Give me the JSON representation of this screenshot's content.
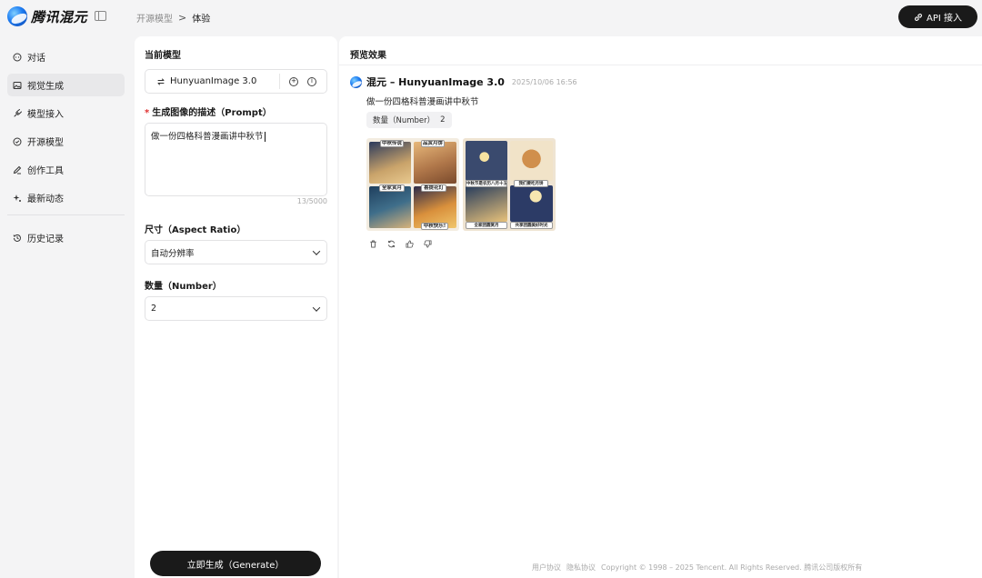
{
  "brand": {
    "name": "腾讯混元"
  },
  "breadcrumb": {
    "parent": "开源模型",
    "separator": ">",
    "current": "体验"
  },
  "header": {
    "api_button": "API 接入"
  },
  "nav": {
    "items": [
      {
        "label": "对话",
        "icon": "chat-icon",
        "active": false
      },
      {
        "label": "视觉生成",
        "icon": "image-icon",
        "active": true
      },
      {
        "label": "模型接入",
        "icon": "plugin-icon",
        "active": false
      },
      {
        "label": "开源模型",
        "icon": "open-source-icon",
        "active": false
      },
      {
        "label": "创作工具",
        "icon": "pen-icon",
        "active": false
      },
      {
        "label": "最新动态",
        "icon": "sparkle-icon",
        "active": false
      }
    ],
    "history": {
      "label": "历史记录",
      "icon": "history-icon"
    }
  },
  "config": {
    "model_section": "当前模型",
    "model_name": "HunyuanImage 3.0",
    "prompt_label": "生成图像的描述（Prompt）",
    "prompt_value": "做一份四格科普漫画讲中秋节",
    "prompt_counter": "13/5000",
    "aspect_label": "尺寸（Aspect Ratio）",
    "aspect_value": "自动分辨率",
    "number_label": "数量（Number）",
    "number_value": "2",
    "generate_button": "立即生成（Generate）"
  },
  "preview": {
    "title": "预览效果",
    "message_title": "混元 – HunyuanImage 3.0",
    "message_time": "2025/10/06 16:56",
    "message_prompt": "做一份四格科普漫画讲中秋节",
    "tag_label": "数量（Number）",
    "tag_value": "2",
    "image1_captions": [
      "中秋传说",
      "品赏月饼",
      "全家赏月",
      "喜提花灯",
      "中秋快乐!"
    ],
    "image2_captions": [
      "中秋节是农历八月十五",
      "我们要吃月饼",
      "全家团圆赏月",
      "共享团圆美好时光"
    ]
  },
  "footer": {
    "links": [
      "用户协议",
      "隐私协议"
    ],
    "copyright": "Copyright © 1998 – 2025 Tencent. All Rights Reserved. 腾讯公司版权所有"
  },
  "colors": {
    "primary": "#1a1a1a",
    "accent": "#1d7cf2",
    "required": "#e03131",
    "background": "#f4f4f5"
  }
}
